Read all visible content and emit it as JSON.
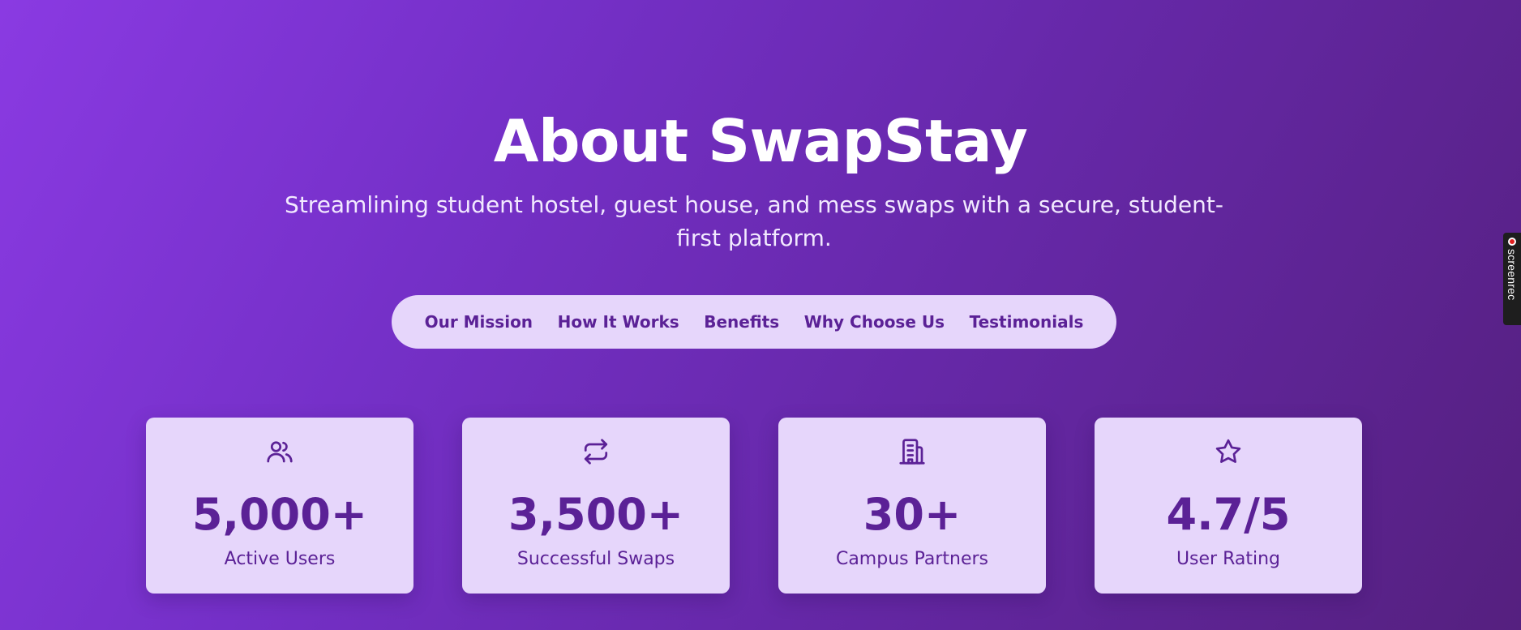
{
  "hero": {
    "title": "About SwapStay",
    "subtitle": "Streamlining student hostel, guest house, and mess swaps with a secure, student-first platform."
  },
  "tabs": [
    {
      "label": "Our Mission"
    },
    {
      "label": "How It Works"
    },
    {
      "label": "Benefits"
    },
    {
      "label": "Why Choose Us"
    },
    {
      "label": "Testimonials"
    }
  ],
  "stats": [
    {
      "icon": "users-icon",
      "value": "5,000+",
      "label": "Active Users"
    },
    {
      "icon": "swap-arrows-icon",
      "value": "3,500+",
      "label": "Successful Swaps"
    },
    {
      "icon": "building-icon",
      "value": "30+",
      "label": "Campus Partners"
    },
    {
      "icon": "star-icon",
      "value": "4.7/5",
      "label": "User Rating"
    }
  ],
  "recorder_badge": {
    "text": "screenrec"
  },
  "colors": {
    "background_start": "#8a3ae2",
    "background_end": "#55207f",
    "card_bg": "#e6d6fb",
    "accent": "#5b2196",
    "title": "#ffffff"
  }
}
